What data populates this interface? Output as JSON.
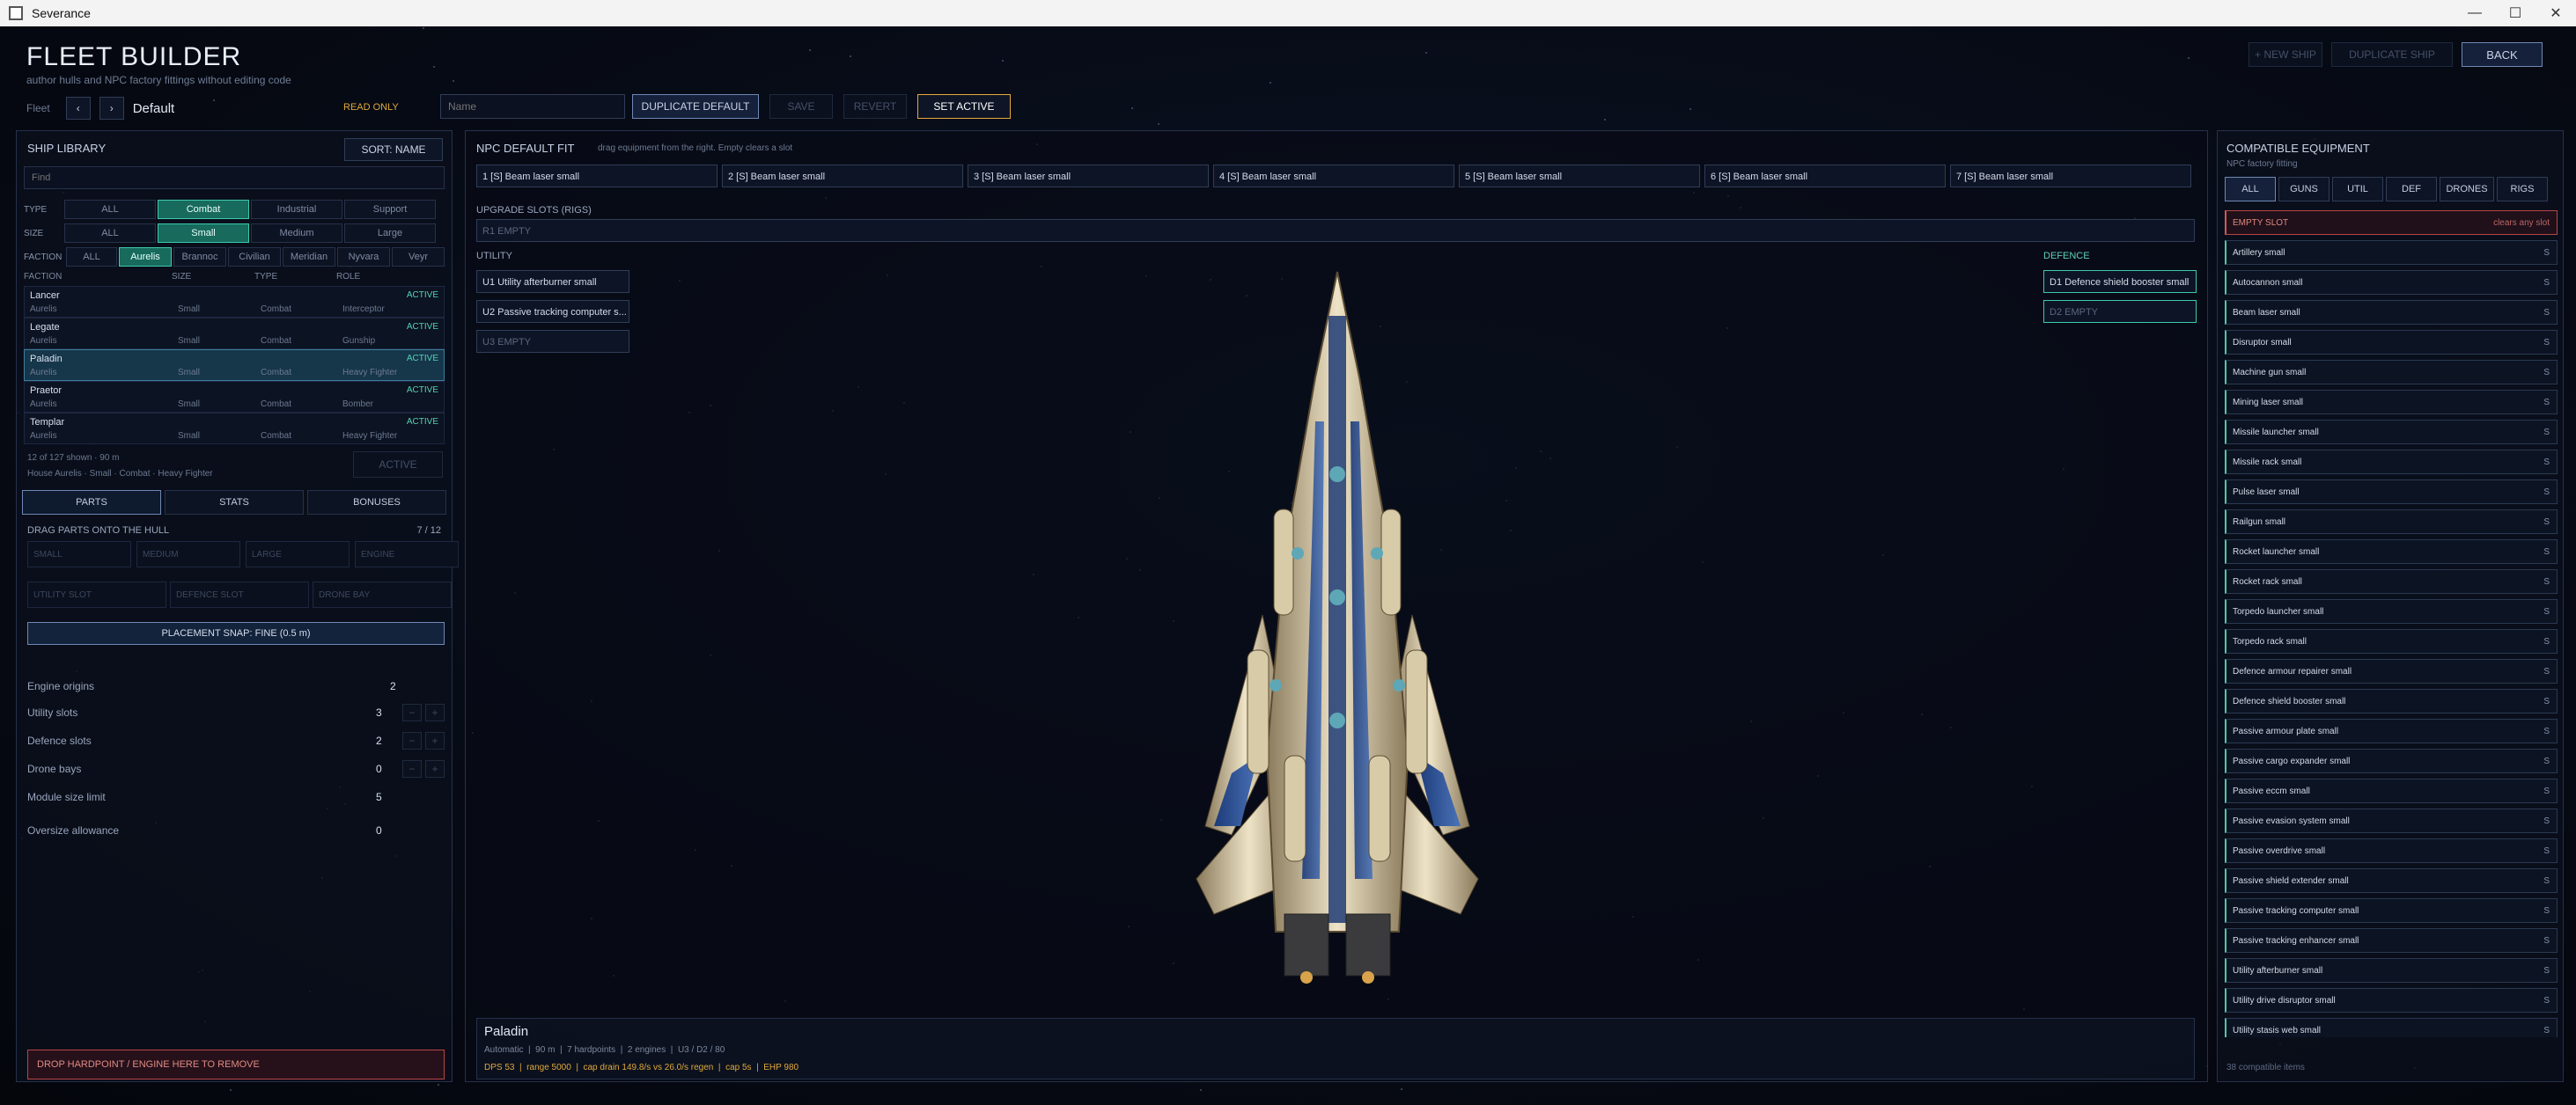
{
  "window": {
    "title": "Severance",
    "minimize": "—",
    "maximize": "☐",
    "close": "✕"
  },
  "header": {
    "title": "FLEET BUILDER",
    "subtitle": "author hulls and NPC factory fittings without editing code",
    "new_ship": "+ NEW SHIP",
    "duplicate_ship": "DUPLICATE SHIP",
    "back": "BACK",
    "fleet_label": "Fleet",
    "fleet_prev": "‹",
    "fleet_next": "›",
    "fleet_name": "Default",
    "read_only": "READ ONLY",
    "name_placeholder": "Name",
    "duplicate_default": "DUPLICATE DEFAULT",
    "save": "SAVE",
    "revert": "REVERT",
    "set_active": "SET ACTIVE"
  },
  "library": {
    "title": "SHIP LIBRARY",
    "sort": "SORT: NAME",
    "find_placeholder": "Find",
    "type_label": "TYPE",
    "types": [
      {
        "label": "ALL",
        "on": false
      },
      {
        "label": "Combat",
        "on": true
      },
      {
        "label": "Industrial",
        "on": false
      },
      {
        "label": "Support",
        "on": false
      }
    ],
    "size_label": "SIZE",
    "sizes": [
      {
        "label": "ALL",
        "on": false
      },
      {
        "label": "Small",
        "on": true
      },
      {
        "label": "Medium",
        "on": false
      },
      {
        "label": "Large",
        "on": false
      }
    ],
    "faction_label": "FACTION",
    "factions": [
      {
        "label": "ALL",
        "on": false
      },
      {
        "label": "Aurelis",
        "on": true
      },
      {
        "label": "Brannoc",
        "on": false
      },
      {
        "label": "Civilian",
        "on": false
      },
      {
        "label": "Meridian",
        "on": false
      },
      {
        "label": "Nyvara",
        "on": false
      },
      {
        "label": "Veyr",
        "on": false
      }
    ],
    "columns": [
      "FACTION",
      "SIZE",
      "TYPE",
      "ROLE"
    ],
    "ships": [
      {
        "name": "Lancer",
        "status": "ACTIVE",
        "faction": "Aurelis",
        "size": "Small",
        "type": "Combat",
        "role": "Interceptor",
        "selected": false
      },
      {
        "name": "Legate",
        "status": "ACTIVE",
        "faction": "Aurelis",
        "size": "Small",
        "type": "Combat",
        "role": "Gunship",
        "selected": false
      },
      {
        "name": "Paladin",
        "status": "ACTIVE",
        "faction": "Aurelis",
        "size": "Small",
        "type": "Combat",
        "role": "Heavy Fighter",
        "selected": true
      },
      {
        "name": "Praetor",
        "status": "ACTIVE",
        "faction": "Aurelis",
        "size": "Small",
        "type": "Combat",
        "role": "Bomber",
        "selected": false
      },
      {
        "name": "Templar",
        "status": "ACTIVE",
        "faction": "Aurelis",
        "size": "Small",
        "type": "Combat",
        "role": "Heavy Fighter",
        "selected": false
      }
    ],
    "shown_count": "12 of 127 shown · 90 m",
    "house_line": "House Aurelis · Small · Combat · Heavy Fighter",
    "active_btn": "ACTIVE",
    "tabs": [
      {
        "label": "PARTS",
        "on": true
      },
      {
        "label": "STATS",
        "on": false
      },
      {
        "label": "BONUSES",
        "on": false
      }
    ],
    "drag_title": "DRAG PARTS ONTO THE HULL",
    "drag_count": "7 / 12",
    "part_buttons": [
      "SMALL",
      "MEDIUM",
      "LARGE",
      "ENGINE"
    ],
    "slot_buttons": [
      "UTILITY SLOT",
      "DEFENCE SLOT",
      "DRONE BAY"
    ],
    "snap": "PLACEMENT SNAP: FINE (0.5 m)",
    "stats": [
      {
        "label": "Engine origins",
        "value": "2",
        "steppers": false
      },
      {
        "label": "Utility slots",
        "value": "3",
        "steppers": true
      },
      {
        "label": "Defence slots",
        "value": "2",
        "steppers": true
      },
      {
        "label": "Drone bays",
        "value": "0",
        "steppers": true
      },
      {
        "label": "Module size limit",
        "value": "5",
        "steppers": false
      },
      {
        "label": "Oversize allowance",
        "value": "0",
        "steppers": false
      }
    ],
    "stepper_minus": "−",
    "stepper_plus": "+",
    "drop_zone": "DROP HARDPOINT / ENGINE HERE TO REMOVE"
  },
  "fit": {
    "title": "NPC DEFAULT FIT",
    "hint": "drag equipment from the right. Empty clears a slot",
    "weapons": [
      "1 [S] Beam laser small",
      "2 [S] Beam laser small",
      "3 [S] Beam laser small",
      "4 [S] Beam laser small",
      "5 [S] Beam laser small",
      "6 [S] Beam laser small",
      "7 [S] Beam laser small"
    ],
    "upgrade_title": "UPGRADE SLOTS (RIGS)",
    "rig_slot": "R1 EMPTY",
    "utility_title": "UTILITY",
    "utility": [
      {
        "label": "U1 Utility afterburner small",
        "empty": false
      },
      {
        "label": "U2 Passive tracking computer s...",
        "empty": false
      },
      {
        "label": "U3 EMPTY",
        "empty": true
      }
    ],
    "defence_title": "DEFENCE",
    "defence": [
      {
        "label": "D1 Defence shield booster small",
        "empty": false
      },
      {
        "label": "D2 EMPTY",
        "empty": true
      }
    ],
    "info_name": "Paladin",
    "info_line": "Automatic  |  90 m  |  7 hardpoints  |  2 engines  |  U3 / D2 / 80",
    "info_stats": "DPS 53  |  range 5000  |  cap drain 149.8/s vs 26.0/s regen  |  cap 5s  |  EHP 980"
  },
  "equipment": {
    "title": "COMPATIBLE EQUIPMENT",
    "subtitle": "NPC factory fitting",
    "filters": [
      {
        "label": "ALL",
        "on": true
      },
      {
        "label": "GUNS",
        "on": false
      },
      {
        "label": "UTIL",
        "on": false
      },
      {
        "label": "DEF",
        "on": false
      },
      {
        "label": "DRONES",
        "on": false
      },
      {
        "label": "RIGS",
        "on": false
      }
    ],
    "items": [
      {
        "label": "EMPTY SLOT",
        "size": "clears any slot",
        "empty": true
      },
      {
        "label": "Artillery small",
        "size": "S"
      },
      {
        "label": "Autocannon small",
        "size": "S"
      },
      {
        "label": "Beam laser small",
        "size": "S"
      },
      {
        "label": "Disruptor small",
        "size": "S"
      },
      {
        "label": "Machine gun small",
        "size": "S"
      },
      {
        "label": "Mining laser small",
        "size": "S"
      },
      {
        "label": "Missile launcher small",
        "size": "S"
      },
      {
        "label": "Missile rack small",
        "size": "S"
      },
      {
        "label": "Pulse laser small",
        "size": "S"
      },
      {
        "label": "Railgun small",
        "size": "S"
      },
      {
        "label": "Rocket launcher small",
        "size": "S"
      },
      {
        "label": "Rocket rack small",
        "size": "S"
      },
      {
        "label": "Torpedo launcher small",
        "size": "S"
      },
      {
        "label": "Torpedo rack small",
        "size": "S"
      },
      {
        "label": "Defence armour repairer small",
        "size": "S"
      },
      {
        "label": "Defence shield booster small",
        "size": "S"
      },
      {
        "label": "Passive armour plate small",
        "size": "S"
      },
      {
        "label": "Passive cargo expander small",
        "size": "S"
      },
      {
        "label": "Passive eccm small",
        "size": "S"
      },
      {
        "label": "Passive evasion system small",
        "size": "S"
      },
      {
        "label": "Passive overdrive small",
        "size": "S"
      },
      {
        "label": "Passive shield extender small",
        "size": "S"
      },
      {
        "label": "Passive tracking computer small",
        "size": "S"
      },
      {
        "label": "Passive tracking enhancer small",
        "size": "S"
      },
      {
        "label": "Utility afterburner small",
        "size": "S"
      },
      {
        "label": "Utility drive disruptor small",
        "size": "S"
      },
      {
        "label": "Utility stasis web small",
        "size": "S"
      }
    ],
    "footer": "38 compatible items"
  }
}
